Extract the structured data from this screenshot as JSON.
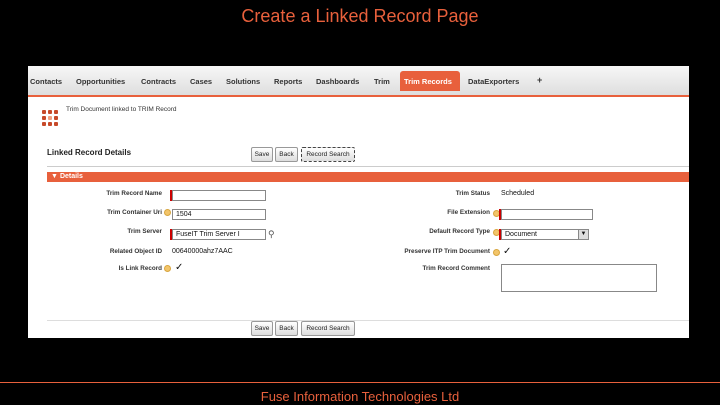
{
  "slide": {
    "title": "Create a Linked Record Page",
    "footer": "Fuse Information Technologies Ltd"
  },
  "tabs": [
    {
      "label": "Contacts"
    },
    {
      "label": "Opportunities"
    },
    {
      "label": "Contracts"
    },
    {
      "label": "Cases"
    },
    {
      "label": "Solutions"
    },
    {
      "label": "Reports"
    },
    {
      "label": "Dashboards"
    },
    {
      "label": "Trim"
    },
    {
      "label": "Trim Records",
      "active": true
    },
    {
      "label": "DataExporters"
    },
    {
      "label": "+"
    }
  ],
  "header": {
    "subtitle": "Trim Document linked to TRIM Record"
  },
  "detail": {
    "title": "Linked Record Details",
    "buttons": {
      "save": "Save",
      "back": "Back",
      "search": "Record Search"
    },
    "section": "Details",
    "fields": {
      "trim_record_name": {
        "label": "Trim Record Name",
        "value": ""
      },
      "trim_container_uri": {
        "label": "Trim Container Uri",
        "value": "1504"
      },
      "trim_server": {
        "label": "Trim Server",
        "value": "FuseIT Trim Server I"
      },
      "related_object_id": {
        "label": "Related Object ID",
        "value": "00640000ahz7AAC"
      },
      "is_link_record": {
        "label": "Is Link Record",
        "checked": true
      },
      "trim_status": {
        "label": "Trim Status",
        "value": "Scheduled"
      },
      "file_extension": {
        "label": "File Extension",
        "value": ""
      },
      "default_record_type": {
        "label": "Default Record Type",
        "value": "Document"
      },
      "preserve_trim_document": {
        "label": "Preserve ITP Trim Document",
        "checked": true
      },
      "trim_record_comment": {
        "label": "Trim Record Comment",
        "value": ""
      }
    }
  },
  "colors": {
    "accent": "#e8603c",
    "background": "#000000"
  },
  "icons": {
    "check": "✓",
    "lookup": "lookup-icon",
    "help": "help-icon"
  }
}
